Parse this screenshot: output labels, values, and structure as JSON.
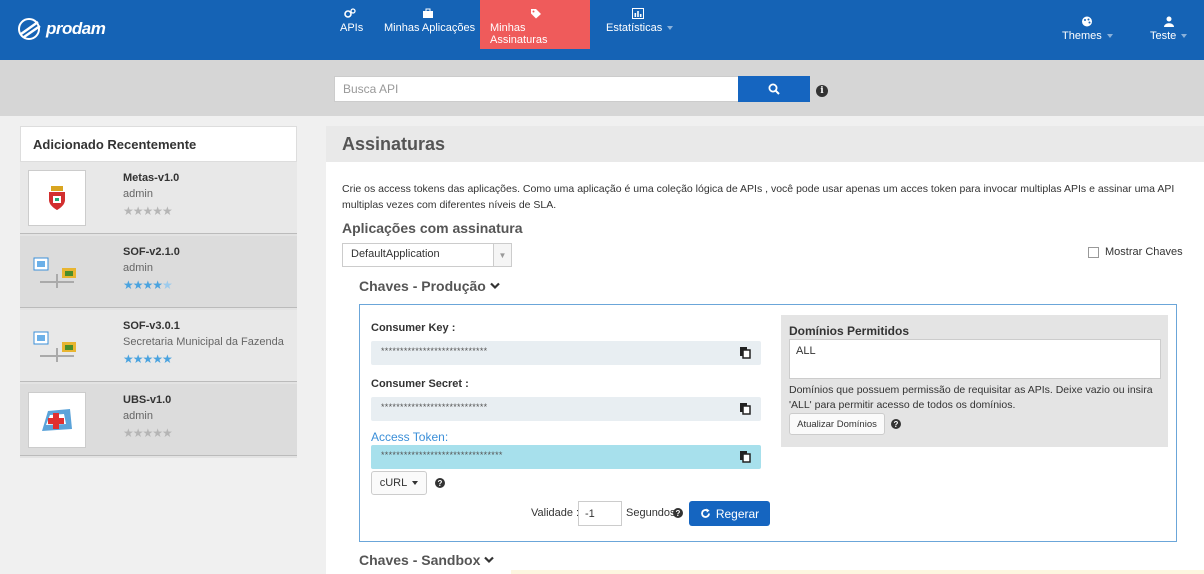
{
  "navbar": {
    "brand": "prodam",
    "items": [
      {
        "label": "APIs",
        "icon": "cogs-icon"
      },
      {
        "label": "Minhas Aplicações",
        "icon": "briefcase-icon"
      },
      {
        "label": "Minhas Assinaturas",
        "icon": "tags-icon",
        "active": true
      },
      {
        "label": "Estatísticas",
        "icon": "chart-icon"
      }
    ],
    "themes_label": "Themes",
    "user_label": "Teste"
  },
  "search": {
    "placeholder": "Busca API"
  },
  "recent": {
    "title": "Adicionado Recentemente",
    "items": [
      {
        "name": "Metas-v1.0",
        "owner": "admin",
        "rating": 0,
        "thumb": "coat-of-arms-icon"
      },
      {
        "name": "SOF-v2.1.0",
        "owner": "admin",
        "rating": 4.5,
        "thumb": "scale-icon"
      },
      {
        "name": "SOF-v3.0.1",
        "owner": "Secretaria Municipal da Fazenda",
        "rating": 5,
        "thumb": "scale-icon"
      },
      {
        "name": "UBS-v1.0",
        "owner": "admin",
        "rating": 0,
        "thumb": "medical-map-icon"
      }
    ]
  },
  "main": {
    "title": "Assinaturas",
    "description": "Crie os access tokens das aplicações. Como uma aplicação é uma coleção lógica de APIs , você pode usar apenas um acces token para invocar multiplas APIs e assinar uma API multiplas vezes com diferentes níveis de SLA.",
    "apps_title": "Aplicações com assinatura",
    "selected_app": "DefaultApplication",
    "show_keys_label": "Mostrar Chaves",
    "production": {
      "title": "Chaves - Produção",
      "consumer_key_label": "Consumer Key :",
      "consumer_key_value": "****************************",
      "consumer_secret_label": "Consumer Secret :",
      "consumer_secret_value": "****************************",
      "access_token_label": "Access Token:",
      "access_token_value": "********************************",
      "curl_label": "cURL",
      "validity_label": "Validade :",
      "validity_value": "-1",
      "seconds_label": "Segundos",
      "regenerate_label": "Regerar",
      "domains_title": "Domínios Permitidos",
      "domains_value": "ALL",
      "domains_help": "Domínios que possuem permissão de requisitar as APIs. Deixe vazio ou insira 'ALL' para permitir acesso de todos os domínios.",
      "update_domains_label": "Atualizar Domínios"
    },
    "sandbox_title": "Chaves - Sandbox"
  },
  "colors": {
    "navbar": "#1563b5",
    "active_tab": "#ef5b5b",
    "primary_button": "#1565c0",
    "star_filled": "#4aa3df",
    "star_empty": "#b5b5b5"
  }
}
